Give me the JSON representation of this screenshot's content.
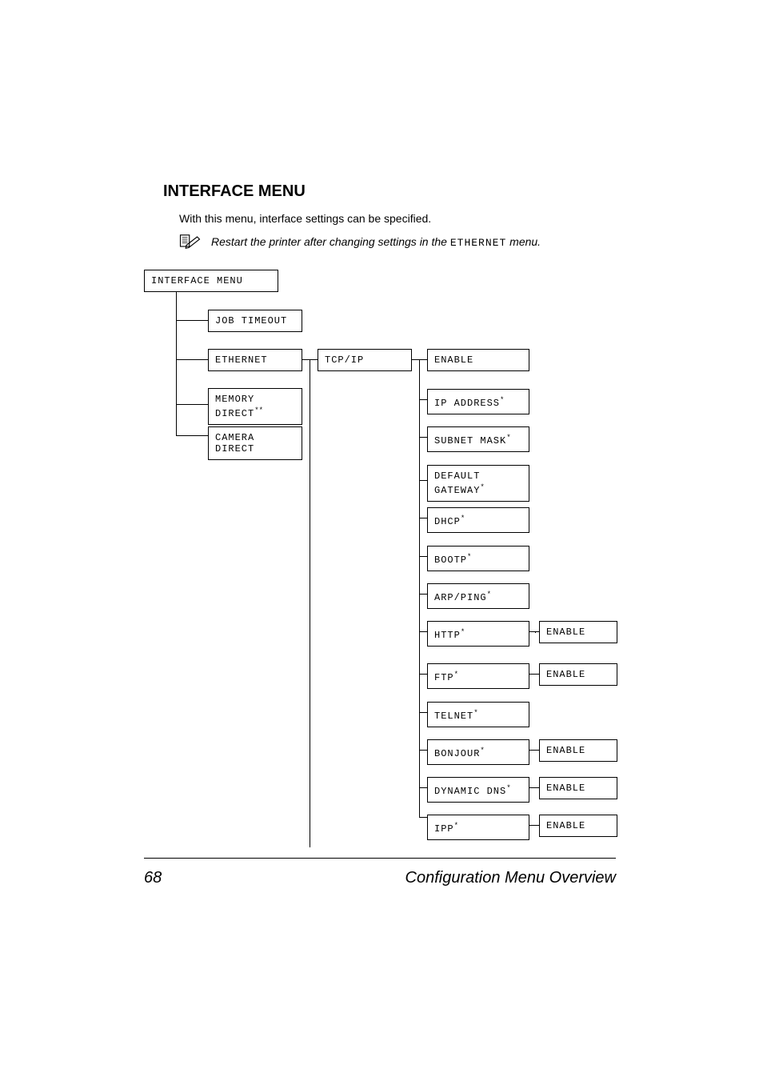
{
  "heading": "INTERFACE MENU",
  "intro": "With this menu, interface settings can be specified.",
  "note": {
    "pre": "Restart the printer after changing settings in the ",
    "mono": "ETHERNET",
    "post": " menu."
  },
  "root": "INTERFACE MENU",
  "col1": {
    "job_timeout": "JOB TIMEOUT",
    "ethernet": "ETHERNET",
    "memory_direct": "MEMORY\nDIRECT",
    "memory_direct_sup": "**",
    "camera_direct": "CAMERA\nDIRECT"
  },
  "col2": {
    "tcpip": "TCP/IP"
  },
  "col3": {
    "enable1": "ENABLE",
    "ip_address": "IP ADDRESS",
    "subnet_mask": "SUBNET MASK",
    "default_gateway": "DEFAULT\nGATEWAY",
    "dhcp": "DHCP",
    "bootp": "BOOTP",
    "arp_ping": "ARP/PING",
    "http": "HTTP",
    "ftp": "FTP",
    "telnet": "TELNET",
    "bonjour": "BONJOUR",
    "dynamic_dns": "DYNAMIC DNS",
    "ipp": "IPP",
    "star": "*"
  },
  "col4": {
    "enable": "ENABLE"
  },
  "footer": {
    "page": "68",
    "title": "Configuration Menu Overview"
  }
}
